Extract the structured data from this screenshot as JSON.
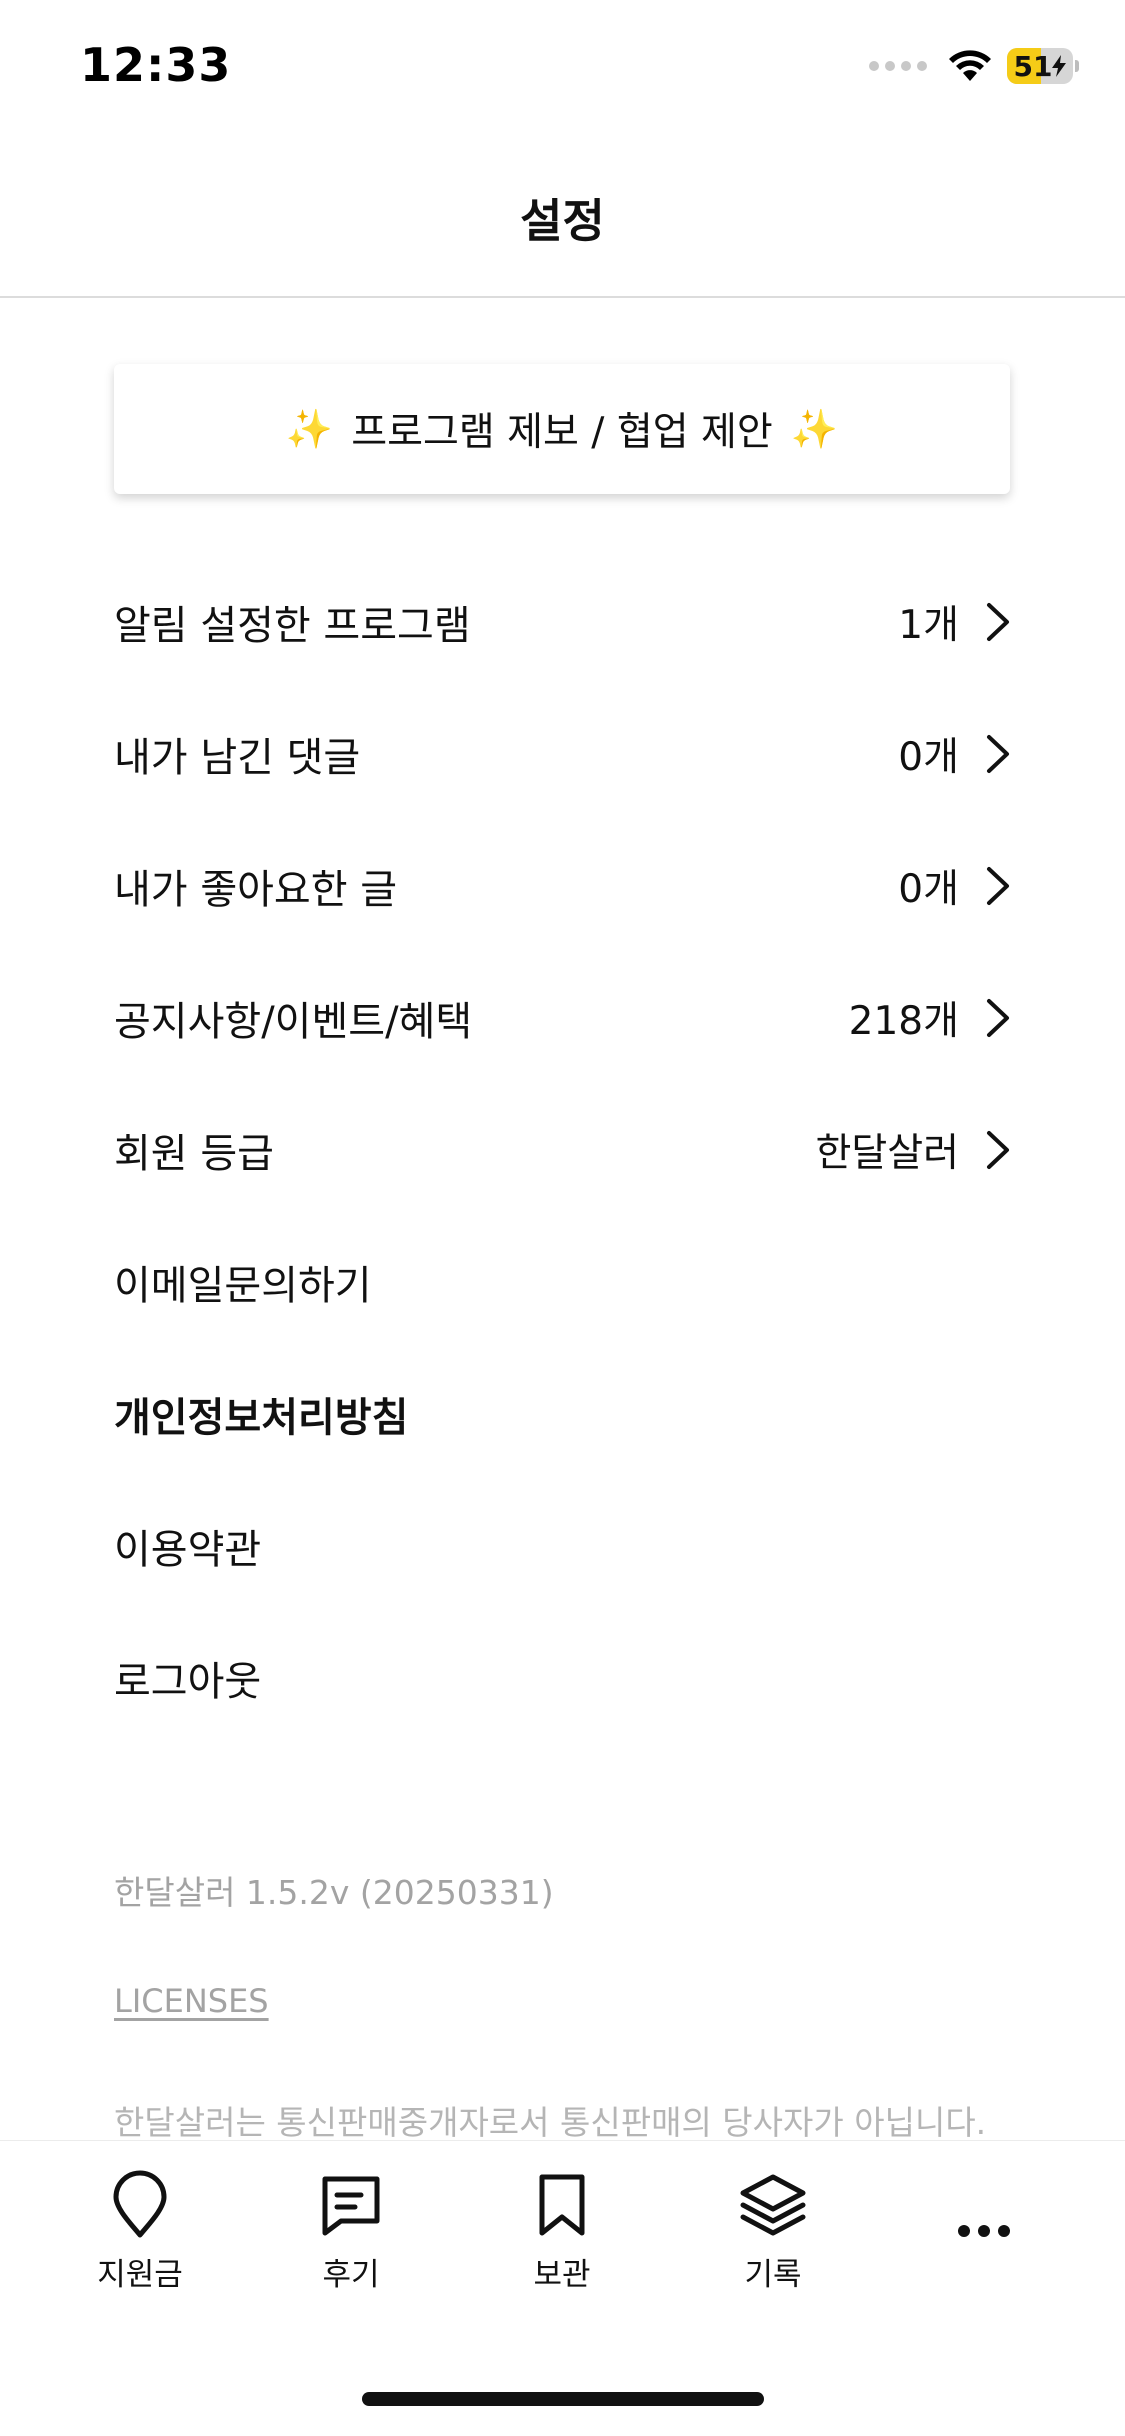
{
  "status_bar": {
    "time": "12:33",
    "battery_text": "51",
    "battery_level": 0.51,
    "battery_color": "#f5cc17"
  },
  "header": {
    "title": "설정"
  },
  "suggest_button": {
    "label": "프로그램 제보 / 협업 제안",
    "icon": "sparkles-icon"
  },
  "menu": {
    "items": [
      {
        "label": "알림 설정한 프로그램",
        "value": "1개"
      },
      {
        "label": "내가 남긴 댓글",
        "value": "0개"
      },
      {
        "label": "내가 좋아요한 글",
        "value": "0개"
      },
      {
        "label": "공지사항/이벤트/혜택",
        "value": "218개"
      },
      {
        "label": "회원 등급",
        "value": "한달살러"
      },
      {
        "label": "이메일문의하기"
      },
      {
        "label": "개인정보처리방침"
      },
      {
        "label": "이용약관"
      },
      {
        "label": "로그아웃"
      }
    ]
  },
  "footer": {
    "version": "한달살러 1.5.2v (20250331)",
    "licenses": "LICENSES",
    "disclaimer": "한달살러는 통신판매중개자로서 통신판매의 당사자가 아닙니다."
  },
  "tab_bar": {
    "items": [
      {
        "label": "지원금",
        "icon": "map-pin-icon"
      },
      {
        "label": "후기",
        "icon": "message-square-icon"
      },
      {
        "label": "보관",
        "icon": "bookmark-icon"
      },
      {
        "label": "기록",
        "icon": "layers-icon"
      },
      {
        "label": "",
        "icon": "more-horizontal-icon"
      }
    ]
  }
}
